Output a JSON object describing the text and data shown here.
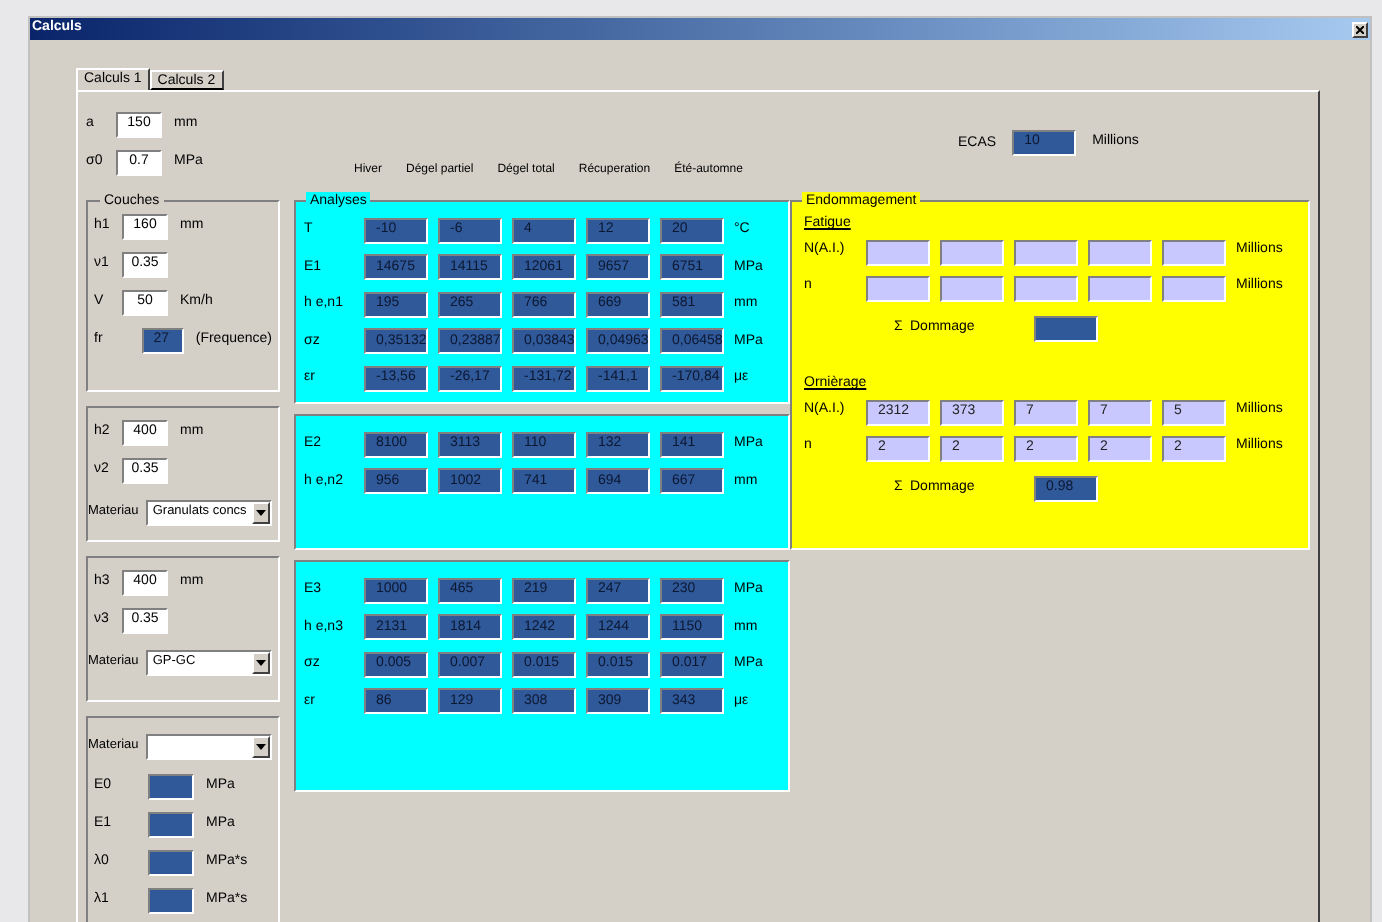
{
  "window": {
    "title": "Calculs"
  },
  "tabs": [
    {
      "label": "Calculs 1",
      "selected": true
    },
    {
      "label": "Calculs 2",
      "selected": false
    }
  ],
  "params": [
    {
      "label": "a",
      "value": "150",
      "unit": "mm"
    },
    {
      "label": "σ0",
      "value": "0.7",
      "unit": "MPa"
    }
  ],
  "ecas": {
    "label": "ECAS",
    "value": "10",
    "unit": "Millions"
  },
  "season_headers": [
    "Hiver",
    "Dégel partiel",
    "Dégel total",
    "Récuperation",
    "Été-automne"
  ],
  "layers": [
    {
      "title": "Couches",
      "fields": [
        {
          "kind": "input",
          "label": "h1",
          "value": "160",
          "unit": "mm"
        },
        {
          "kind": "input",
          "label": "ν1",
          "value": "0.35"
        },
        {
          "kind": "input",
          "label": "V",
          "value": "50",
          "unit": "Km/h"
        },
        {
          "kind": "output",
          "label": "fr",
          "value": "27",
          "unit": "(Frequence)"
        }
      ]
    },
    {
      "fields": [
        {
          "kind": "input",
          "label": "h2",
          "value": "400",
          "unit": "mm"
        },
        {
          "kind": "input",
          "label": "ν2",
          "value": "0.35"
        },
        {
          "kind": "select",
          "label": "Materiau",
          "value": "Granulats concs"
        }
      ]
    },
    {
      "fields": [
        {
          "kind": "input",
          "label": "h3",
          "value": "400",
          "unit": "mm"
        },
        {
          "kind": "input",
          "label": "ν3",
          "value": "0.35"
        },
        {
          "kind": "select",
          "label": "Materiau",
          "value": "GP-GC"
        }
      ]
    },
    {
      "fields": [
        {
          "kind": "select",
          "label": "Materiau"
        },
        {
          "kind": "output",
          "label": "E0",
          "unit": "MPa"
        },
        {
          "kind": "output",
          "label": "E1",
          "unit": "MPa"
        },
        {
          "kind": "output",
          "label": "λ0",
          "unit": "MPa*s"
        },
        {
          "kind": "output",
          "label": "λ1",
          "unit": "MPa*s"
        }
      ]
    }
  ],
  "analyses": [
    {
      "title": "Analyses",
      "rows": [
        {
          "label": "T",
          "values": [
            "-10",
            "-6",
            "4",
            "12",
            "20"
          ],
          "unit": "°C"
        },
        {
          "label": "E1",
          "values": [
            "14675",
            "14115",
            "12061",
            "9657",
            "6751"
          ],
          "unit": "MPa"
        },
        {
          "label": "h e,n1",
          "values": [
            "195",
            "265",
            "766",
            "669",
            "581"
          ],
          "unit": "mm"
        },
        {
          "label": "σz",
          "values": [
            "0,35132",
            "0,23887",
            "0,03843",
            "0,04963",
            "0,06458"
          ],
          "unit": "MPa"
        },
        {
          "label": "εr",
          "values": [
            "-13,56",
            "-26,17",
            "-131,72",
            "-141,1",
            "-170,84"
          ],
          "unit": "με"
        }
      ]
    },
    {
      "rows": [
        {
          "label": "E2",
          "values": [
            "8100",
            "3113",
            "110",
            "132",
            "141"
          ],
          "unit": "MPa"
        },
        {
          "label": "h e,n2",
          "values": [
            "956",
            "1002",
            "741",
            "694",
            "667"
          ],
          "unit": "mm"
        }
      ]
    },
    {
      "rows": [
        {
          "label": "E3",
          "values": [
            "1000",
            "465",
            "219",
            "247",
            "230"
          ],
          "unit": "MPa"
        },
        {
          "label": "h e,n3",
          "values": [
            "2131",
            "1814",
            "1242",
            "1244",
            "1150"
          ],
          "unit": "mm"
        },
        {
          "label": "σz",
          "values": [
            "0.005",
            "0.007",
            "0.015",
            "0.015",
            "0.017"
          ],
          "unit": "MPa"
        },
        {
          "label": "εr",
          "values": [
            "86",
            "129",
            "308",
            "309",
            "343"
          ],
          "unit": "με"
        }
      ]
    }
  ],
  "endommagement": {
    "title": "Endommagement",
    "sections": [
      {
        "title": "Fatigue",
        "rows": [
          {
            "label": "N(A.I.)",
            "cells": [
              {
                "kind": "empty"
              },
              {
                "kind": "empty"
              },
              {
                "kind": "empty"
              },
              {
                "kind": "empty"
              },
              {
                "kind": "empty"
              }
            ],
            "unit": "Millions"
          },
          {
            "label": "n",
            "cells": [
              {
                "kind": "empty"
              },
              {
                "kind": "empty"
              },
              {
                "kind": "empty"
              },
              {
                "kind": "empty"
              },
              {
                "kind": "empty"
              }
            ],
            "unit": "Millions"
          }
        ],
        "sum": {
          "symbol": "Σ",
          "label": "Dommage"
        }
      },
      {
        "title": "Ornièrage",
        "rows": [
          {
            "label": "N(A.I.)",
            "cells": [
              {
                "kind": "value",
                "value": "2312"
              },
              {
                "kind": "value",
                "value": "373"
              },
              {
                "kind": "value",
                "value": "7"
              },
              {
                "kind": "value",
                "value": "7"
              },
              {
                "kind": "value",
                "value": "5"
              }
            ],
            "unit": "Millions"
          },
          {
            "label": "n",
            "cells": [
              {
                "kind": "value",
                "value": "2"
              },
              {
                "kind": "value",
                "value": "2"
              },
              {
                "kind": "value",
                "value": "2"
              },
              {
                "kind": "value",
                "value": "2"
              },
              {
                "kind": "value",
                "value": "2"
              }
            ],
            "unit": "Millions"
          }
        ],
        "sum": {
          "symbol": "Σ",
          "label": "Dommage",
          "value": "0.98"
        }
      }
    ]
  }
}
